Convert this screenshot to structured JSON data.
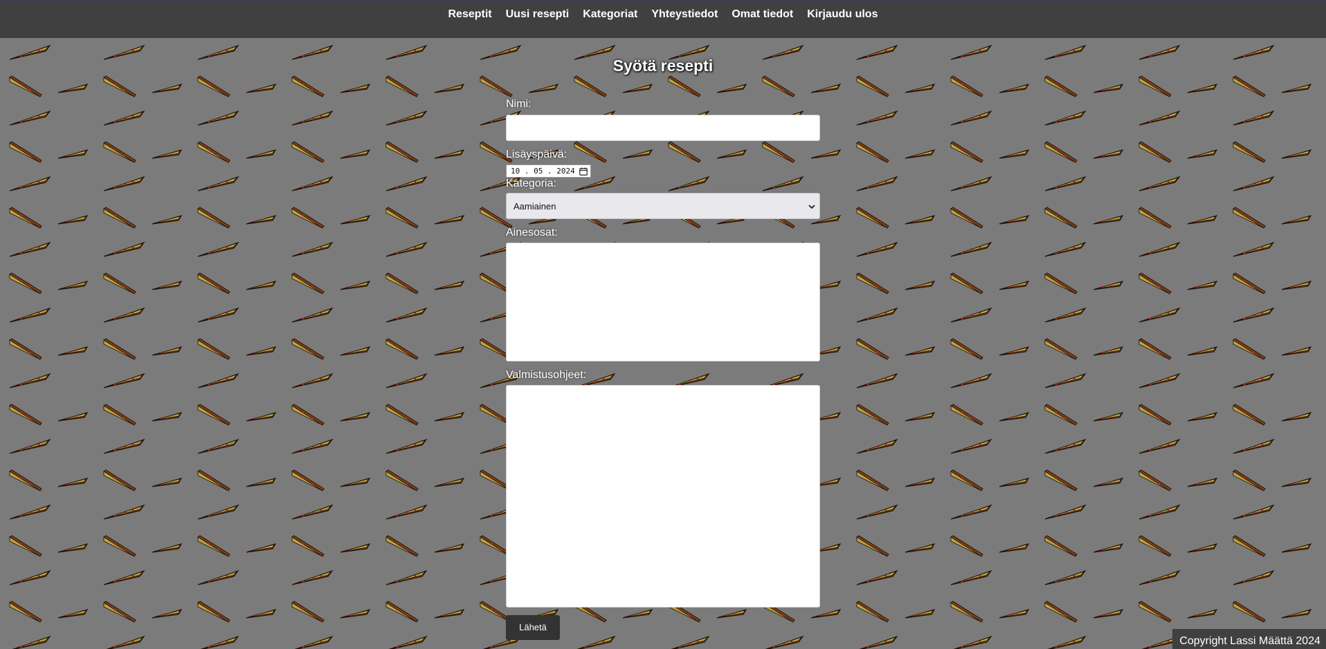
{
  "nav": {
    "items": [
      {
        "label": "Reseptit"
      },
      {
        "label": "Uusi resepti"
      },
      {
        "label": "Kategoriat"
      },
      {
        "label": "Yhteystiedot"
      },
      {
        "label": "Omat tiedot"
      },
      {
        "label": "Kirjaudu ulos"
      }
    ]
  },
  "page": {
    "title": "Syötä resepti"
  },
  "form": {
    "name_label": "Nimi:",
    "name_value": "",
    "date_label": "Lisäyspäivä:",
    "date_day": "10",
    "date_month": "05",
    "date_year": "2024",
    "date_sep": ".",
    "category_label": "Kategoria:",
    "category_value": "Aamiainen",
    "ingredients_label": "Ainesosat:",
    "ingredients_value": "",
    "instructions_label": "Valmistusohjeet:",
    "instructions_value": "",
    "submit_label": "Lähetä"
  },
  "icons": {
    "calendar": "calendar-icon",
    "select_arrow": "chevron-down-icon",
    "background": "pizza-slice-pattern"
  },
  "colors": {
    "topbar": "#404040",
    "background": "#7b7b7b",
    "button": "#333333"
  },
  "footer": {
    "copyright": "Copyright Lassi Määttä 2024"
  }
}
